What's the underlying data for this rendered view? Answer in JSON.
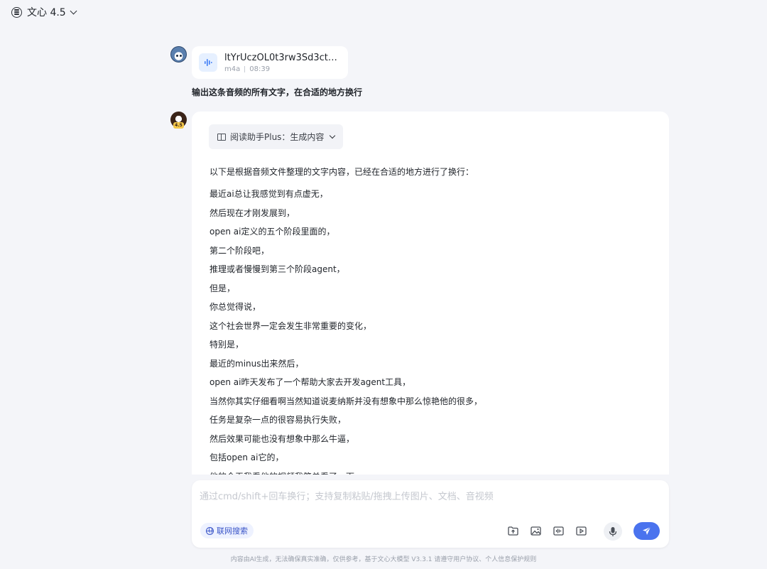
{
  "header": {
    "model_name": "文心 4.5"
  },
  "attachment": {
    "file_name": "ltYrUczOL0t3rw3Sd3ctHi...",
    "file_type": "m4a",
    "duration": "08:39"
  },
  "user_message": "输出这条音频的所有文字，在合适的地方换行",
  "bot": {
    "version_badge": "4.5",
    "plugin_label": "阅读助手Plus：生成内容",
    "intro": "以下是根据音频文件整理的文字内容，已经在合适的地方进行了换行：",
    "lines": [
      "最近ai总让我感觉到有点虚无，",
      "然后现在才刚发展到，",
      "open ai定义的五个阶段里面的，",
      "第二个阶段吧，",
      "推理或者慢慢到第三个阶段agent，",
      "但是，",
      "你总觉得说，",
      "这个社会世界一定会发生非常重要的变化，",
      "特别是，",
      "最近的minus出来然后，",
      "open ai昨天发布了一个帮助大家去开发agent工具，",
      "当然你其实仔细看啊当然知道说麦纳斯并没有想象中那么惊艳他的很多，",
      "任务是复杂一点的很容易执行失败，",
      "然后效果可能也没有想象中那么牛逼，",
      "包括open ai它的，",
      "他的今天我看他的视频我简单看了一下"
    ]
  },
  "composer": {
    "placeholder": "通过cmd/shift+回车换行；支持复制粘贴/拖拽上传图片、文档、音视频",
    "web_search_label": "联网搜索"
  },
  "footer": "内容由AI生成，无法确保真实准确，仅供参考，基于文心大模型 V3.3.1 请遵守用户协议、个人信息保护规则",
  "colors": {
    "accent": "#4a73ee",
    "page_bg": "#f4f5f9",
    "search_chip_bg": "#eef2ff"
  }
}
